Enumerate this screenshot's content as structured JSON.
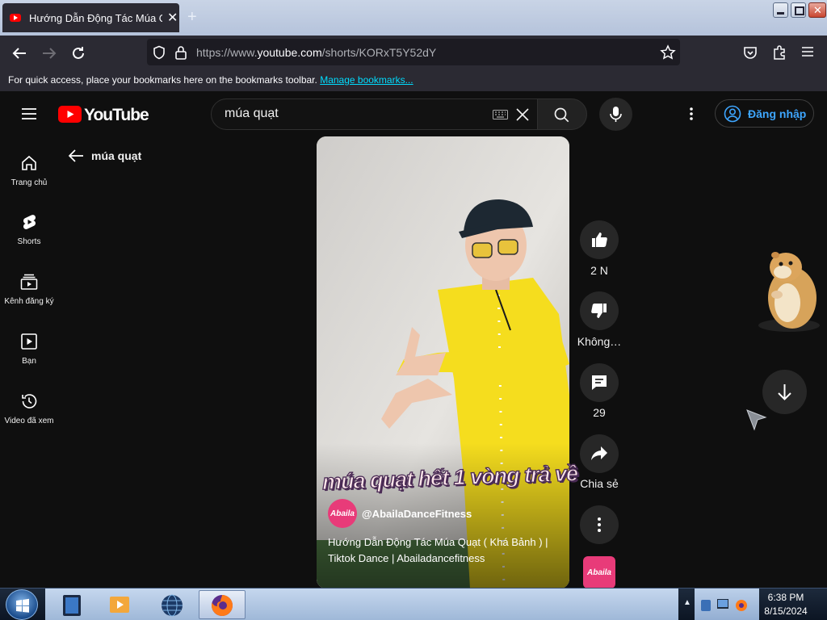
{
  "browser": {
    "tab_title": "Hướng Dẫn Động Tác Múa Quạt",
    "tab_close": "✕",
    "new_tab": "+",
    "url_prefix": "https://www.",
    "url_host": "youtube.com",
    "url_path": "/shorts/KORxT5Y52dY",
    "bookmarks_text": "For quick access, place your bookmarks here on the bookmarks toolbar.",
    "manage_bookmarks": "Manage bookmarks..."
  },
  "youtube": {
    "logo_text": "YouTube",
    "search_value": "múa quạt",
    "signin_label": "Đăng nhập",
    "sidebar": [
      {
        "label": "Trang chủ",
        "icon": "home-icon"
      },
      {
        "label": "Shorts",
        "icon": "shorts-icon"
      },
      {
        "label": "Kênh đăng ký",
        "icon": "subscriptions-icon"
      },
      {
        "label": "Bạn",
        "icon": "you-icon"
      },
      {
        "label": "Video đã xem",
        "icon": "history-icon"
      }
    ],
    "back_title": "múa quạt"
  },
  "short": {
    "caption": "múa quạt hết 1 vòng trả về",
    "channel_avatar_text": "Abaila",
    "channel_name": "@AbailaDanceFitness",
    "description": "Hướng Dẫn Động Tác Múa Quạt ( Khá Bảnh ) | Tiktok Dance | Abailadancefitness",
    "actions": {
      "like_count": "2 N",
      "dislike_label": "Không…",
      "comment_count": "29",
      "share_label": "Chia sẻ"
    },
    "channel_thumb_text": "Abaila"
  },
  "taskbar": {
    "time": "6:38 PM",
    "date": "8/15/2024"
  },
  "colors": {
    "yt_red": "#ff0000",
    "link_blue": "#3ea6ff",
    "shirt_yellow": "#f5dd1e",
    "brand_pink": "#e83b79"
  }
}
